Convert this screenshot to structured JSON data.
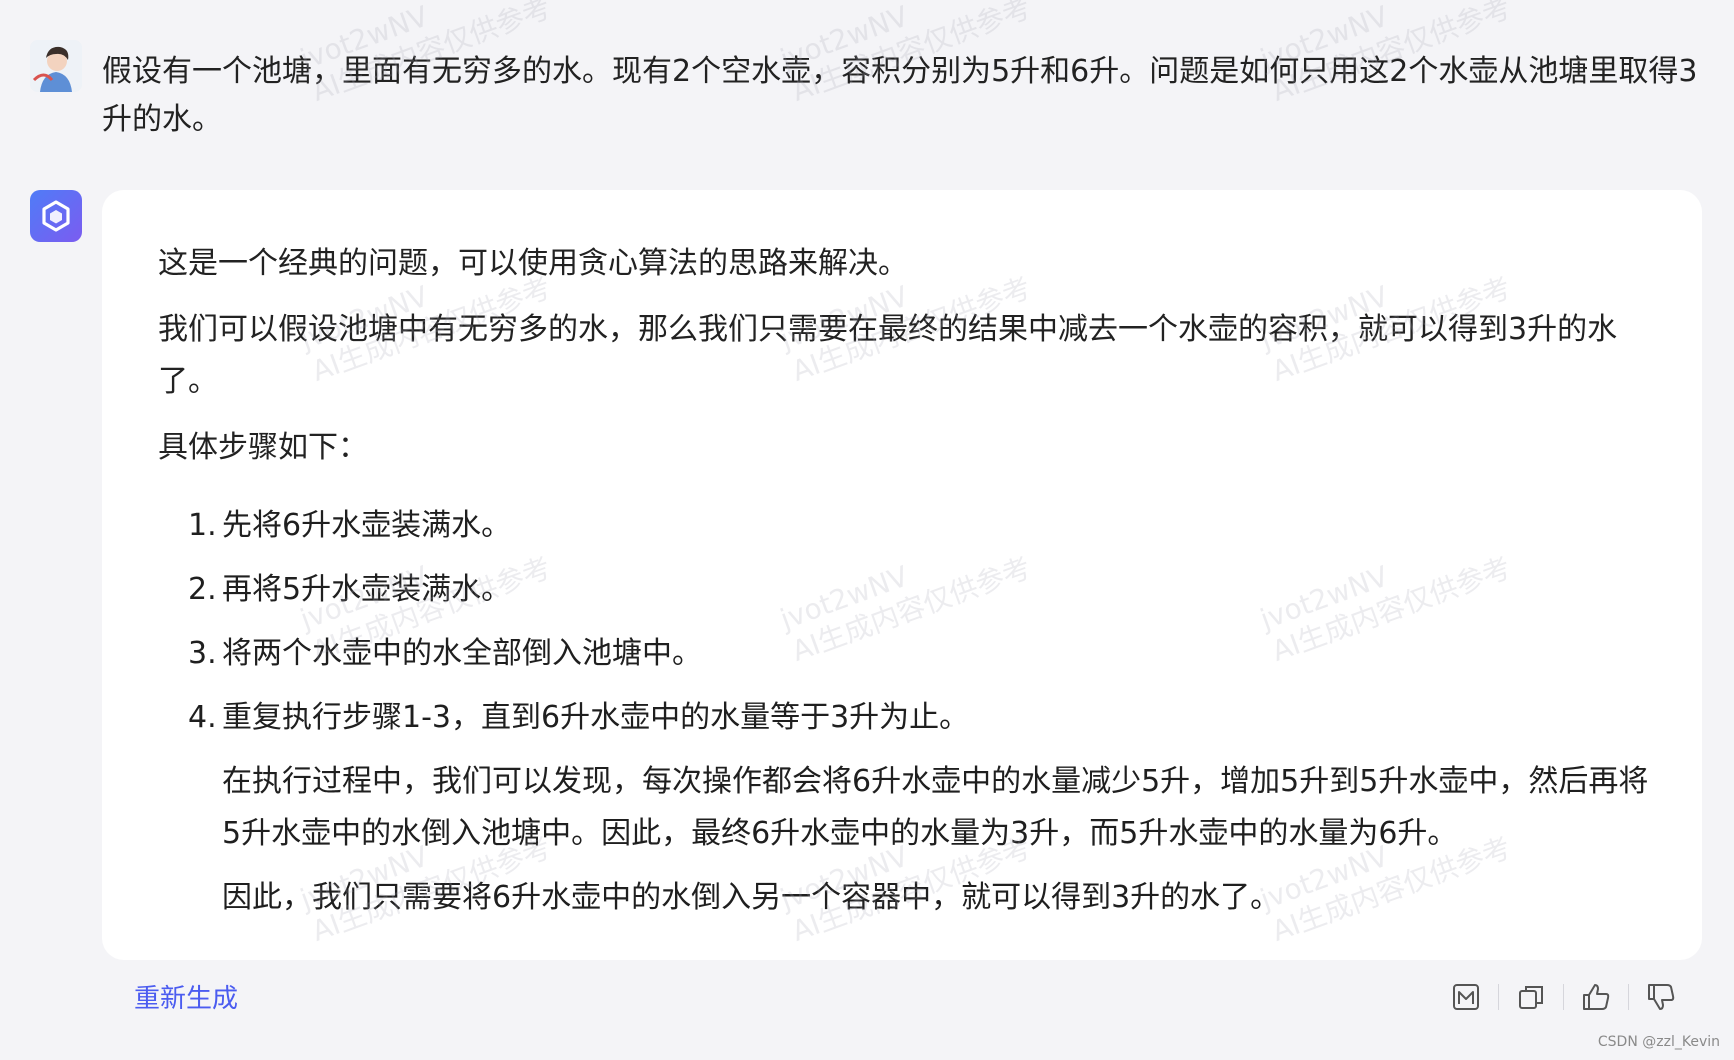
{
  "user": {
    "message": "假设有一个池塘，里面有无穷多的水。现有2个空水壶，容积分别为5升和6升。问题是如何只用这2个水壶从池塘里取得3升的水。"
  },
  "answer": {
    "intro": "这是一个经典的问题，可以使用贪心算法的思路来解决。",
    "para2": "我们可以假设池塘中有无穷多的水，那么我们只需要在最终的结果中减去一个水壶的容积，就可以得到3升的水了。",
    "steps_title": "具体步骤如下：",
    "steps": [
      {
        "num": "1.",
        "text": "先将6升水壶装满水。"
      },
      {
        "num": "2.",
        "text": "再将5升水壶装满水。"
      },
      {
        "num": "3.",
        "text": "将两个水壶中的水全部倒入池塘中。"
      },
      {
        "num": "4.",
        "text": "重复执行步骤1-3，直到6升水壶中的水量等于3升为止。"
      }
    ],
    "sub1": "在执行过程中，我们可以发现，每次操作都会将6升水壶中的水量减少5升，增加5升到5升水壶中，然后再将5升水壶中的水倒入池塘中。因此，最终6升水壶中的水量为3升，而5升水壶中的水量为6升。",
    "sub2": "因此，我们只需要将6升水壶中的水倒入另一个容器中，就可以得到3升的水了。"
  },
  "footer": {
    "regenerate": "重新生成",
    "credit": "CSDN @zzl_Kevin"
  },
  "watermark": {
    "line1": "jvot2wNV",
    "line2": "AI生成内容仅供参考"
  },
  "colors": {
    "accent": "#4b5cf0",
    "background": "#f4f4f7",
    "card": "#ffffff"
  }
}
